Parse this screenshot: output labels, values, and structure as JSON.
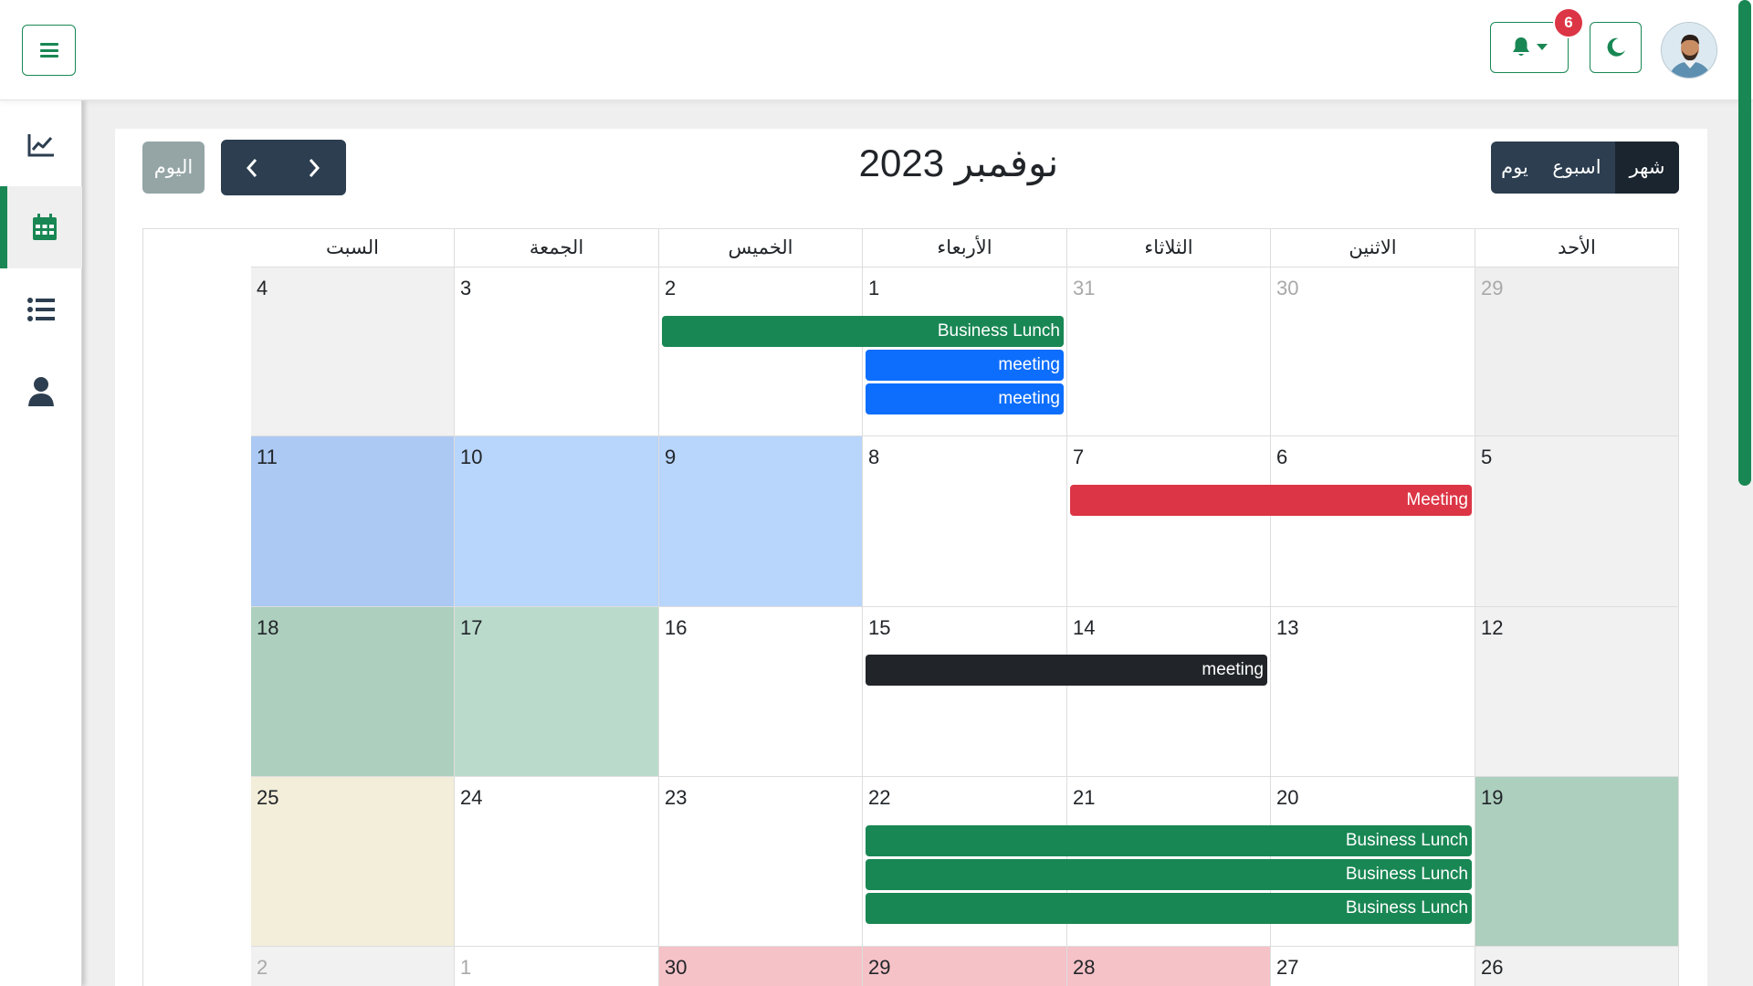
{
  "header": {
    "notification_count": "6",
    "icons": {
      "menu": "menu-icon",
      "bell": "bell-icon",
      "caret": "caret-down-icon",
      "moon": "moon-icon",
      "avatar": "user-avatar"
    }
  },
  "sidebar": {
    "items": [
      {
        "name": "chart-line-icon",
        "active": false
      },
      {
        "name": "calendar-icon",
        "active": true
      },
      {
        "name": "list-icon",
        "active": false
      },
      {
        "name": "user-icon",
        "active": false
      }
    ]
  },
  "calendar": {
    "title": "نوفمبر 2023",
    "views": {
      "month": "شهر",
      "week": "اسبوع",
      "day": "يوم"
    },
    "active_view": "month",
    "today_label": "اليوم",
    "weekdays": [
      "الأحد",
      "الاثنين",
      "الثلاثاء",
      "الأربعاء",
      "الخميس",
      "الجمعة",
      "السبت"
    ],
    "weeks": [
      [
        "29",
        "30",
        "31",
        "1",
        "2",
        "3",
        "4"
      ],
      [
        "5",
        "6",
        "7",
        "8",
        "9",
        "10",
        "11"
      ],
      [
        "12",
        "13",
        "14",
        "15",
        "16",
        "17",
        "18"
      ],
      [
        "19",
        "20",
        "21",
        "22",
        "23",
        "24",
        "25"
      ],
      [
        "26",
        "27",
        "28",
        "29",
        "30",
        "1",
        "2"
      ]
    ],
    "events": [
      {
        "title": "Business Lunch",
        "color": "#198754"
      },
      {
        "title": "meeting",
        "color": "#0d6efd"
      },
      {
        "title": "meeting",
        "color": "#0d6efd"
      },
      {
        "title": "Meeting",
        "color": "#dc3545"
      },
      {
        "title": "meeting",
        "color": "#212529"
      },
      {
        "title": "Business Lunch",
        "color": "#198754"
      },
      {
        "title": "Business Lunch",
        "color": "#198754"
      },
      {
        "title": "Business Lunch",
        "color": "#198754"
      }
    ]
  },
  "colors": {
    "accent": "#198754",
    "nav_dark": "#2c3e50",
    "today_button": "#95a5a6"
  }
}
